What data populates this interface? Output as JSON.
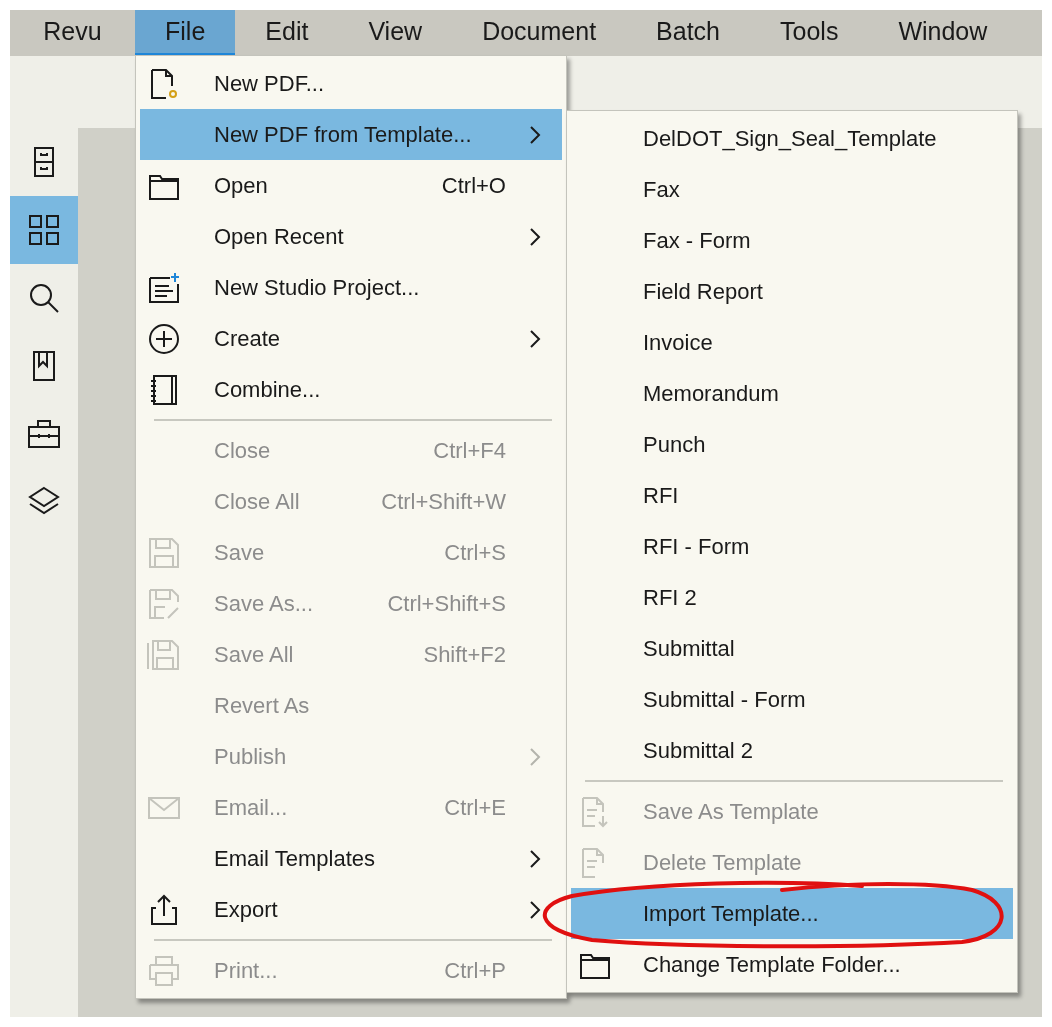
{
  "menubar": [
    {
      "label": "Revu",
      "selected": false
    },
    {
      "label": "File",
      "selected": true
    },
    {
      "label": "Edit",
      "selected": false
    },
    {
      "label": "View",
      "selected": false
    },
    {
      "label": "Document",
      "selected": false
    },
    {
      "label": "Batch",
      "selected": false
    },
    {
      "label": "Tools",
      "selected": false
    },
    {
      "label": "Window",
      "selected": false
    }
  ],
  "sidebar": [
    {
      "kind": "cabinet",
      "selected": false
    },
    {
      "kind": "grid",
      "selected": true
    },
    {
      "kind": "search",
      "selected": false
    },
    {
      "kind": "bookmark",
      "selected": false
    },
    {
      "kind": "toolbox",
      "selected": false
    },
    {
      "kind": "layers",
      "selected": false
    }
  ],
  "file_menu": {
    "items": [
      {
        "kind": "item",
        "label": "New PDF...",
        "disabled": false,
        "selected": false
      },
      {
        "kind": "item",
        "label": "New PDF from Template...",
        "submenu": true,
        "disabled": false,
        "selected": true
      },
      {
        "kind": "item",
        "label": "Open",
        "shortcut": "Ctrl+O",
        "disabled": false,
        "selected": false
      },
      {
        "kind": "item",
        "label": "Open Recent",
        "submenu": true,
        "disabled": false,
        "selected": false
      },
      {
        "kind": "item",
        "label": "New Studio Project...",
        "disabled": false,
        "selected": false
      },
      {
        "kind": "item",
        "label": "Create",
        "submenu": true,
        "disabled": false,
        "selected": false
      },
      {
        "kind": "item",
        "label": "Combine...",
        "disabled": false,
        "selected": false
      },
      {
        "kind": "separator"
      },
      {
        "kind": "item",
        "label": "Close",
        "shortcut": "Ctrl+F4",
        "disabled": true,
        "selected": false
      },
      {
        "kind": "item",
        "label": "Close All",
        "shortcut": "Ctrl+Shift+W",
        "disabled": true,
        "selected": false
      },
      {
        "kind": "item",
        "label": "Save",
        "shortcut": "Ctrl+S",
        "disabled": true,
        "selected": false
      },
      {
        "kind": "item",
        "label": "Save As...",
        "shortcut": "Ctrl+Shift+S",
        "disabled": true,
        "selected": false
      },
      {
        "kind": "item",
        "label": "Save All",
        "shortcut": "Shift+F2",
        "disabled": true,
        "selected": false
      },
      {
        "kind": "item",
        "label": "Revert As",
        "disabled": true,
        "selected": false
      },
      {
        "kind": "item",
        "label": "Publish",
        "submenu": true,
        "disabled": true,
        "selected": false
      },
      {
        "kind": "item",
        "label": "Email...",
        "shortcut": "Ctrl+E",
        "disabled": true,
        "selected": false
      },
      {
        "kind": "item",
        "label": "Email Templates",
        "submenu": true,
        "disabled": false,
        "selected": false
      },
      {
        "kind": "item",
        "label": "Export",
        "submenu": true,
        "disabled": false,
        "selected": false
      },
      {
        "kind": "separator"
      },
      {
        "kind": "item",
        "label": "Print...",
        "shortcut": "Ctrl+P",
        "disabled": true,
        "selected": false
      }
    ]
  },
  "template_menu": {
    "items": [
      {
        "kind": "item",
        "label": "DelDOT_Sign_Seal_Template",
        "disabled": false,
        "selected": false
      },
      {
        "kind": "item",
        "label": "Fax",
        "disabled": false,
        "selected": false
      },
      {
        "kind": "item",
        "label": "Fax - Form",
        "disabled": false,
        "selected": false
      },
      {
        "kind": "item",
        "label": "Field Report",
        "disabled": false,
        "selected": false
      },
      {
        "kind": "item",
        "label": "Invoice",
        "disabled": false,
        "selected": false
      },
      {
        "kind": "item",
        "label": "Memorandum",
        "disabled": false,
        "selected": false
      },
      {
        "kind": "item",
        "label": "Punch",
        "disabled": false,
        "selected": false
      },
      {
        "kind": "item",
        "label": "RFI",
        "disabled": false,
        "selected": false
      },
      {
        "kind": "item",
        "label": "RFI - Form",
        "disabled": false,
        "selected": false
      },
      {
        "kind": "item",
        "label": "RFI 2",
        "disabled": false,
        "selected": false
      },
      {
        "kind": "item",
        "label": "Submittal",
        "disabled": false,
        "selected": false
      },
      {
        "kind": "item",
        "label": "Submittal - Form",
        "disabled": false,
        "selected": false
      },
      {
        "kind": "item",
        "label": "Submittal 2",
        "disabled": false,
        "selected": false
      },
      {
        "kind": "separator"
      },
      {
        "kind": "item",
        "label": "Save As Template",
        "disabled": true,
        "selected": false
      },
      {
        "kind": "item",
        "label": "Delete Template",
        "disabled": true,
        "selected": false
      },
      {
        "kind": "item",
        "label": "Import Template...",
        "disabled": false,
        "selected": true,
        "circled": true
      },
      {
        "kind": "item",
        "label": "Change Template Folder...",
        "disabled": false,
        "selected": false
      }
    ]
  }
}
